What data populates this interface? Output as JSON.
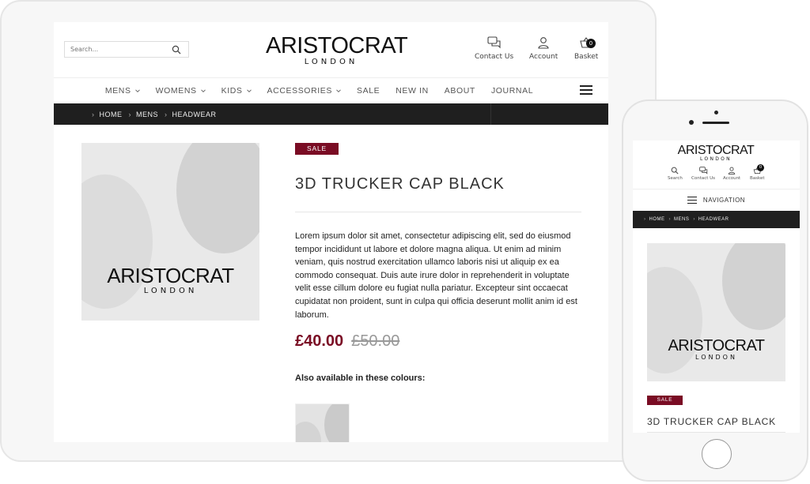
{
  "tablet": {
    "search": {
      "placeholder": "Search..."
    },
    "logo": {
      "line1": "ARISTOCRAT",
      "line2": "LONDON"
    },
    "header_icons": [
      {
        "label": "Contact Us",
        "icon": "chat-icon"
      },
      {
        "label": "Account",
        "icon": "user-icon"
      },
      {
        "label": "Basket",
        "icon": "basket-icon",
        "count": "0"
      }
    ],
    "nav": [
      {
        "label": "MENS",
        "dropdown": true
      },
      {
        "label": "WOMENS",
        "dropdown": true
      },
      {
        "label": "KIDS",
        "dropdown": true
      },
      {
        "label": "ACCESSORIES",
        "dropdown": true
      },
      {
        "label": "SALE",
        "dropdown": false
      },
      {
        "label": "NEW IN",
        "dropdown": false
      },
      {
        "label": "ABOUT",
        "dropdown": false
      },
      {
        "label": "JOURNAL",
        "dropdown": false
      }
    ],
    "breadcrumb": [
      "HOME",
      "MENS",
      "HEADWEAR"
    ],
    "product": {
      "image_logo_line1": "ARISTOCRAT",
      "image_logo_line2": "LONDON",
      "sale_tag": "SALE",
      "title": "3D TRUCKER CAP BLACK",
      "description": "Lorem ipsum dolor sit amet, consectetur adipiscing elit, sed do eiusmod tempor incididunt ut labore et dolore magna aliqua. Ut enim ad minim veniam, quis nostrud exercitation ullamco laboris nisi ut aliquip ex ea commodo consequat. Duis aute irure dolor in reprehenderit in voluptate velit esse cillum dolore eu fugiat nulla pariatur. Excepteur sint occaecat cupidatat non proident, sunt in culpa qui officia deserunt mollit anim id est laborum.",
      "price_now": "£40.00",
      "price_was": "£50.00",
      "colours_label": "Also available in these colours:"
    }
  },
  "phone": {
    "logo": {
      "line1": "ARISTOCRAT",
      "line2": "LONDON"
    },
    "icons": [
      {
        "label": "Search",
        "icon": "search-icon"
      },
      {
        "label": "Contact Us",
        "icon": "chat-icon"
      },
      {
        "label": "Account",
        "icon": "user-icon"
      },
      {
        "label": "Basket",
        "icon": "basket-icon",
        "count": "0"
      }
    ],
    "nav_label": "NAVIGATION",
    "breadcrumb": [
      "HOME",
      "MENS",
      "HEADWEAR"
    ],
    "product": {
      "image_logo_line1": "ARISTOCRAT",
      "image_logo_line2": "LONDON",
      "sale_tag": "SALE",
      "title": "3D TRUCKER CAP BLACK"
    }
  },
  "colors": {
    "accent": "#7a0c24",
    "breadcrumb_bg": "#1f1f1f",
    "price_was": "#999999"
  }
}
